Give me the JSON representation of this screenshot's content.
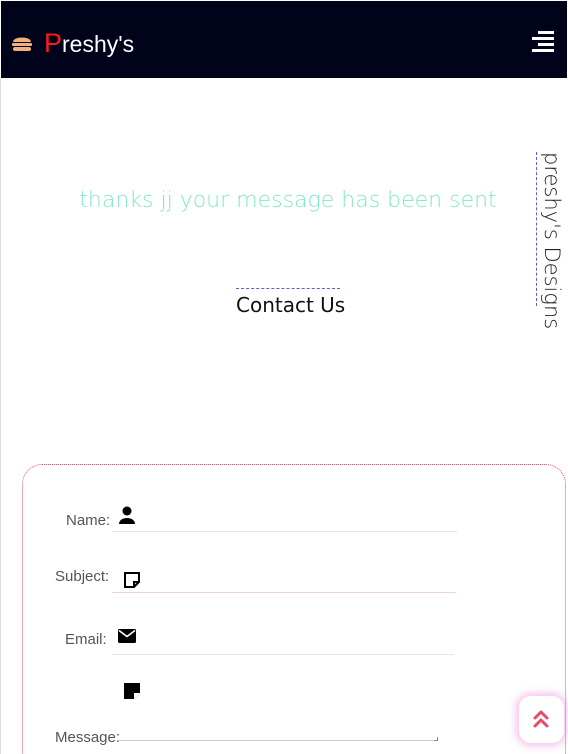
{
  "navbar": {
    "brand_first": "P",
    "brand_rest": "reshy's",
    "brand_icon": "burger-icon",
    "menu_icon": "hamburger-menu-icon"
  },
  "side_brand": "preshy's Designs",
  "status_message": "thanks jj your message has been sent",
  "contact": {
    "heading": "Contact Us",
    "fields": {
      "name": {
        "label": "Name:",
        "icon": "user-icon"
      },
      "subject": {
        "label": "Subject:",
        "icon": "note-icon"
      },
      "email": {
        "label": "Email:",
        "icon": "envelope-icon"
      },
      "message": {
        "label": "Message:",
        "icon": "sticky-note-icon"
      }
    }
  },
  "scroll_top": {
    "icon": "double-chevron-up-icon"
  },
  "colors": {
    "nav_bg": "#00031a",
    "brand_accent": "#ff1a1a",
    "success": "#7fe8c8",
    "card_accent": "#cc4d8a",
    "dashed_accent": "#7d52c9"
  }
}
